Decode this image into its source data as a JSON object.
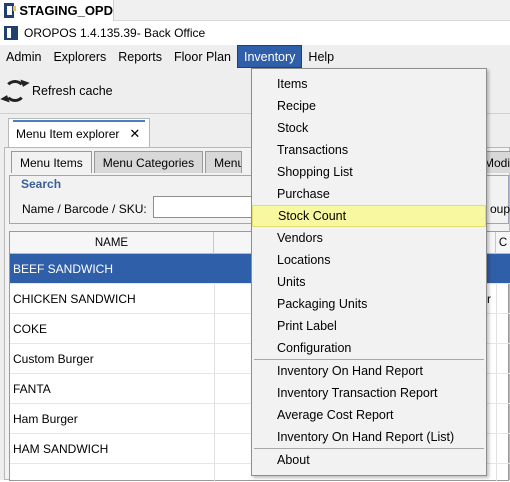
{
  "taskbar": {
    "label": "STAGING_OPD"
  },
  "window": {
    "title": "OROPOS 1.4.135.39- Back Office"
  },
  "menubar": {
    "items": [
      {
        "label": "Admin"
      },
      {
        "label": "Explorers"
      },
      {
        "label": "Reports"
      },
      {
        "label": "Floor Plan"
      },
      {
        "label": "Inventory"
      },
      {
        "label": "Help"
      }
    ],
    "active": "Inventory"
  },
  "toolbar": {
    "refresh_label": "Refresh cache"
  },
  "doc_tab": {
    "label": "Menu Item explorer",
    "close": "✕"
  },
  "subtabs": [
    {
      "label": "Menu Items"
    },
    {
      "label": "Menu Categories"
    },
    {
      "label": "Menu G"
    },
    {
      "label": "Modif"
    }
  ],
  "search": {
    "legend": "Search",
    "label": "Name / Barcode / SKU:",
    "value": "",
    "right_text": "oup"
  },
  "table": {
    "columns": [
      "NAME",
      "T",
      "C"
    ],
    "rows": [
      {
        "name": "BEEF SANDWICH",
        "selected": true
      },
      {
        "name": "CHICKEN SANDWICH",
        "extra": "r"
      },
      {
        "name": "COKE"
      },
      {
        "name": "Custom Burger"
      },
      {
        "name": "FANTA"
      },
      {
        "name": "Ham Burger"
      },
      {
        "name": "HAM SANDWICH"
      }
    ]
  },
  "inventory_menu": {
    "groups": [
      [
        "Items",
        "Recipe",
        "Stock",
        "Transactions",
        "Shopping List",
        "Purchase",
        "Stock Count",
        "Vendors",
        "Locations",
        "Units",
        "Packaging Units",
        "Print Label",
        "Configuration"
      ],
      [
        "Inventory On Hand Report",
        "Inventory Transaction Report",
        "Average Cost Report",
        "Inventory On Hand Report (List)"
      ],
      [
        "About"
      ]
    ],
    "highlighted": "Stock Count"
  },
  "colors": {
    "selection": "#2f5fa8",
    "highlight": "#f8f8a0"
  }
}
